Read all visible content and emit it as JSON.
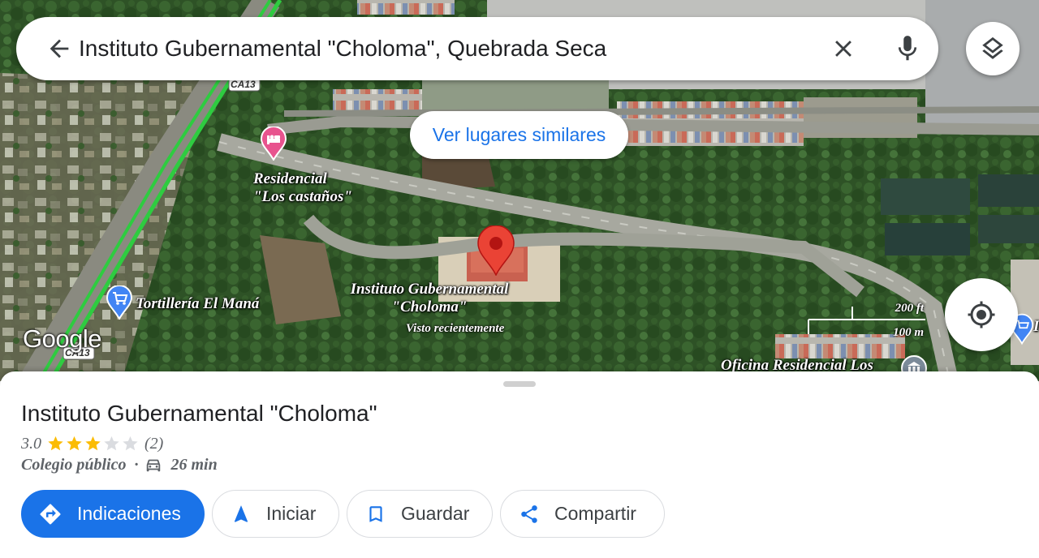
{
  "search": {
    "query": "Instituto Gubernamental \"Choloma\", Quebrada Seca"
  },
  "map": {
    "similar_places_label": "Ver lugares similares",
    "road_label": "CA13",
    "road_label_2": "CA13",
    "logo_text": "Google",
    "scale_ft": "200 ft",
    "scale_m": "100 m",
    "places": [
      {
        "name_line1": "Residencial",
        "name_line2": "\"Los castaños\"",
        "icon": "hotel-icon"
      },
      {
        "name": "Tortillería El Maná",
        "icon": "shopping-cart-icon"
      },
      {
        "name_line1": "Instituto Gubernamental",
        "name_line2": "\"Choloma\"",
        "sub": "Visto recientemente",
        "icon": "red-pin-icon"
      },
      {
        "name": "Oficina Residencial Los",
        "icon": "institution-icon"
      }
    ],
    "edge_label": "I"
  },
  "sheet": {
    "title": "Instituto Gubernamental \"Choloma\"",
    "rating": "3.0",
    "rating_value": 3,
    "rating_max": 5,
    "review_count": "(2)",
    "category": "Colegio público",
    "separator": "·",
    "drive_time": "26 min",
    "actions": {
      "directions": "Indicaciones",
      "start": "Iniciar",
      "save": "Guardar",
      "share": "Compartir"
    }
  },
  "colors": {
    "accent": "#1a73e8",
    "star": "#fbbc04",
    "star_empty": "#dadce0",
    "pin": "#ea4335"
  }
}
